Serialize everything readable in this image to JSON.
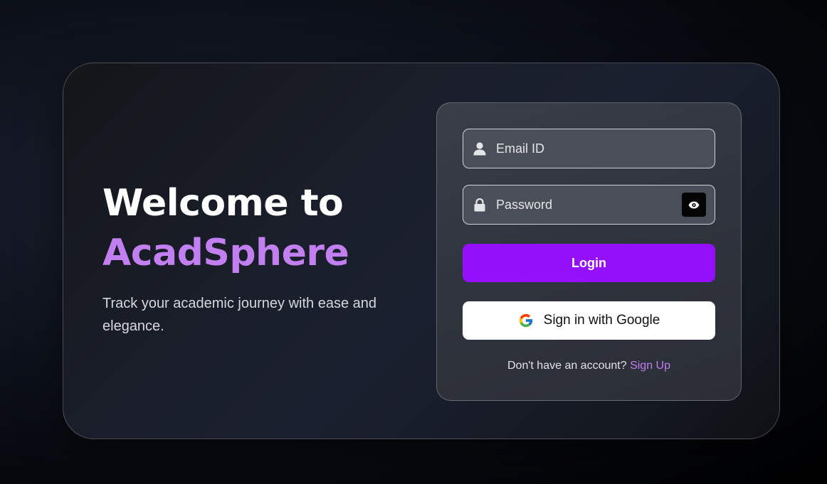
{
  "hero": {
    "title_line1": "Welcome to",
    "brand_name": "AcadSphere",
    "tagline": "Track your academic journey with ease and elegance."
  },
  "form": {
    "email": {
      "placeholder": "Email ID",
      "value": "",
      "icon": "user-icon"
    },
    "password": {
      "placeholder": "Password",
      "value": "",
      "icon": "lock-icon",
      "toggle_icon": "eye-icon"
    },
    "login_label": "Login",
    "google_label": "Sign in with Google",
    "signup_prompt": "Don't have an account?",
    "signup_link": "Sign Up"
  },
  "colors": {
    "brand_purple": "#c17ff0",
    "login_button": "#9410fb",
    "signup_link": "#c07df2"
  }
}
